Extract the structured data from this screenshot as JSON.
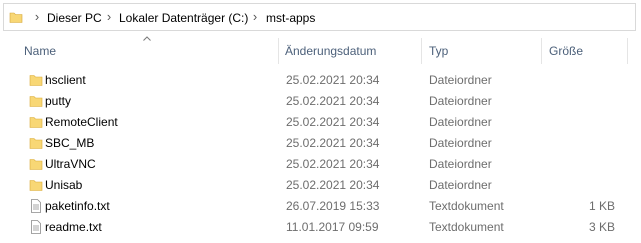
{
  "address_bar": {
    "crumbs": [
      "Dieser PC",
      "Lokaler Datenträger (C:)",
      "mst-apps"
    ]
  },
  "columns": {
    "name": "Name",
    "modified": "Änderungsdatum",
    "type": "Typ",
    "size": "Größe"
  },
  "files": [
    {
      "name": "hsclient",
      "modified": "25.02.2021 20:34",
      "type": "Dateiordner",
      "size": "",
      "icon": "folder-icon"
    },
    {
      "name": "putty",
      "modified": "25.02.2021 20:34",
      "type": "Dateiordner",
      "size": "",
      "icon": "folder-icon"
    },
    {
      "name": "RemoteClient",
      "modified": "25.02.2021 20:34",
      "type": "Dateiordner",
      "size": "",
      "icon": "folder-icon"
    },
    {
      "name": "SBC_MB",
      "modified": "25.02.2021 20:34",
      "type": "Dateiordner",
      "size": "",
      "icon": "folder-icon"
    },
    {
      "name": "UltraVNC",
      "modified": "25.02.2021 20:34",
      "type": "Dateiordner",
      "size": "",
      "icon": "folder-icon"
    },
    {
      "name": "Unisab",
      "modified": "25.02.2021 20:34",
      "type": "Dateiordner",
      "size": "",
      "icon": "folder-icon"
    },
    {
      "name": "paketinfo.txt",
      "modified": "26.07.2019 15:33",
      "type": "Textdokument",
      "size": "1 KB",
      "icon": "text-file-icon"
    },
    {
      "name": "readme.txt",
      "modified": "11.01.2017 09:59",
      "type": "Textdokument",
      "size": "3 KB",
      "icon": "text-file-icon"
    }
  ],
  "colors": {
    "folder": "#f8d775",
    "header_text": "#4c607a",
    "meta_text": "#6d6d6d"
  }
}
